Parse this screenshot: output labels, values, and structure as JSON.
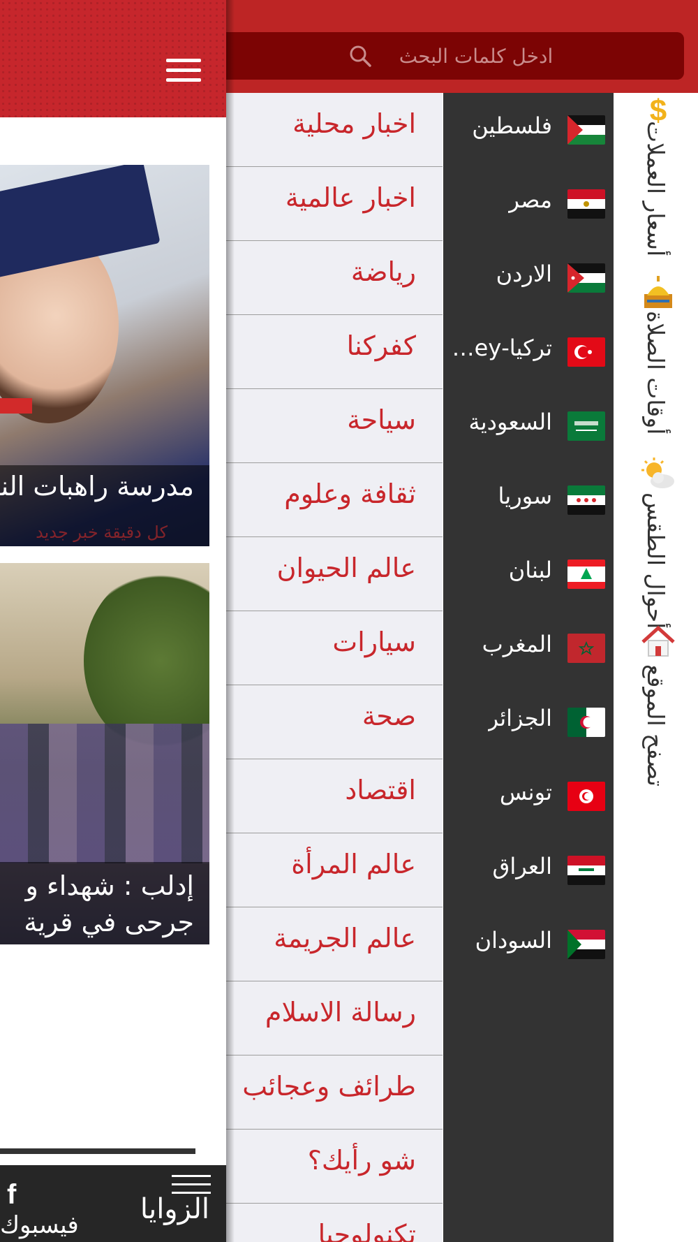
{
  "search": {
    "placeholder": "ادخل كلمات البحث"
  },
  "categories": [
    "اخبار محلية",
    "اخبار عالمية",
    "رياضة",
    "كفركنا",
    "سياحة",
    "ثقافة وعلوم",
    "عالم الحيوان",
    "سيارات",
    "صحة",
    "اقتصاد",
    "عالم المرأة",
    "عالم الجريمة",
    "رسالة الاسلام",
    "طرائف وعجائب",
    "شو رأيك؟",
    "تكنولوجيا"
  ],
  "countries": [
    {
      "name": "فلسطين",
      "flag": "palestine-flag"
    },
    {
      "name": "مصر",
      "flag": "egypt-flag"
    },
    {
      "name": "الاردن",
      "flag": "jordan-flag"
    },
    {
      "name": "تركيا-turkey",
      "flag": "turkey-flag"
    },
    {
      "name": "السعودية",
      "flag": "saudi-flag"
    },
    {
      "name": "سوريا",
      "flag": "syria-flag"
    },
    {
      "name": "لبنان",
      "flag": "lebanon-flag"
    },
    {
      "name": "المغرب",
      "flag": "morocco-flag"
    },
    {
      "name": "الجزائر",
      "flag": "algeria-flag"
    },
    {
      "name": "تونس",
      "flag": "tunisia-flag"
    },
    {
      "name": "العراق",
      "flag": "iraq-flag"
    },
    {
      "name": "السودان",
      "flag": "sudan-flag"
    }
  ],
  "side_links": {
    "currency": "أسعار العملات",
    "prayer": "أوقات الصلاة",
    "weather": "أحوال الطقس",
    "browse": "تصفح الموقع"
  },
  "main": {
    "card1_caption": "مدرسة راهبات الناصرة",
    "card1_watermark": "كل دقيقة خبر جديد",
    "card2_caption": "إدلب : شهداء و جرحى في قرية",
    "bottom_nav": {
      "zawaya": "الزوايا",
      "facebook": "فيسبوك"
    }
  },
  "colors": {
    "brand_red": "#c6262c",
    "search_bg": "#7c0404",
    "category_text": "#c8262b",
    "country_bg": "#333333",
    "category_bg": "#efeff4"
  }
}
